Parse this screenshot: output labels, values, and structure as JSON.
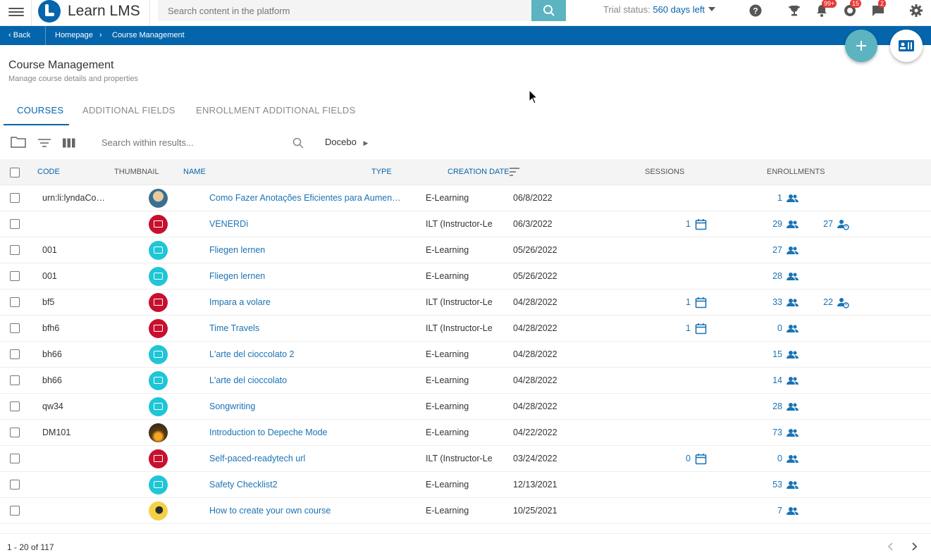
{
  "app": {
    "name": "Learn LMS"
  },
  "search": {
    "placeholder": "Search content in the platform"
  },
  "trial": {
    "label": "Trial status:",
    "value": "560 days left"
  },
  "badges": {
    "notifications": "99+",
    "messages_a": "15",
    "messages_b": "2"
  },
  "breadcrumb": {
    "back": "Back",
    "home": "Homepage",
    "current": "Course Management"
  },
  "page": {
    "title": "Course Management",
    "subtitle": "Manage course details and properties"
  },
  "tabs": [
    {
      "label": "COURSES",
      "active": true
    },
    {
      "label": "ADDITIONAL FIELDS",
      "active": false
    },
    {
      "label": "ENROLLMENT ADDITIONAL FIELDS",
      "active": false
    }
  ],
  "filter": {
    "search_placeholder": "Search within results...",
    "branch": "Docebo"
  },
  "columns": {
    "code": "CODE",
    "thumbnail": "THUMBNAIL",
    "name": "NAME",
    "type": "TYPE",
    "creation_date": "CREATION DATE",
    "sessions": "SESSIONS",
    "enrollments": "ENROLLMENTS"
  },
  "rows": [
    {
      "code": "urn:li:lyndaCourse",
      "thumb": "img1",
      "name": "Como Fazer Anotações Eficientes para Aumenta...",
      "type": "E-Learning",
      "date": "06/8/2022",
      "sessions": "",
      "enrollments": "1",
      "waiting": ""
    },
    {
      "code": "",
      "thumb": "ilt",
      "name": "VENERDì",
      "type": "ILT (Instructor-Le",
      "date": "06/3/2022",
      "sessions": "1",
      "enrollments": "29",
      "waiting": "27"
    },
    {
      "code": "001",
      "thumb": "elearn",
      "name": "Fliegen lernen",
      "type": "E-Learning",
      "date": "05/26/2022",
      "sessions": "",
      "enrollments": "27",
      "waiting": ""
    },
    {
      "code": "001",
      "thumb": "elearn",
      "name": "Fliegen lernen",
      "type": "E-Learning",
      "date": "05/26/2022",
      "sessions": "",
      "enrollments": "28",
      "waiting": ""
    },
    {
      "code": "bf5",
      "thumb": "ilt",
      "name": "Impara a volare",
      "type": "ILT (Instructor-Le",
      "date": "04/28/2022",
      "sessions": "1",
      "enrollments": "33",
      "waiting": "22"
    },
    {
      "code": "bfh6",
      "thumb": "ilt",
      "name": "Time Travels",
      "type": "ILT (Instructor-Le",
      "date": "04/28/2022",
      "sessions": "1",
      "enrollments": "0",
      "waiting": ""
    },
    {
      "code": "bh66",
      "thumb": "elearn",
      "name": "L'arte del cioccolato 2",
      "type": "E-Learning",
      "date": "04/28/2022",
      "sessions": "",
      "enrollments": "15",
      "waiting": ""
    },
    {
      "code": "bh66",
      "thumb": "elearn",
      "name": "L'arte del cioccolato",
      "type": "E-Learning",
      "date": "04/28/2022",
      "sessions": "",
      "enrollments": "14",
      "waiting": ""
    },
    {
      "code": "qw34",
      "thumb": "elearn",
      "name": "Songwriting",
      "type": "E-Learning",
      "date": "04/28/2022",
      "sessions": "",
      "enrollments": "28",
      "waiting": ""
    },
    {
      "code": "DM101",
      "thumb": "img2",
      "name": "Introduction to Depeche Mode",
      "type": "E-Learning",
      "date": "04/22/2022",
      "sessions": "",
      "enrollments": "73",
      "waiting": ""
    },
    {
      "code": "",
      "thumb": "ilt",
      "name": "Self-paced-readytech url",
      "type": "ILT (Instructor-Le",
      "date": "03/24/2022",
      "sessions": "0",
      "enrollments": "0",
      "waiting": ""
    },
    {
      "code": "",
      "thumb": "elearn",
      "name": "Safety Checklist2",
      "type": "E-Learning",
      "date": "12/13/2021",
      "sessions": "",
      "enrollments": "53",
      "waiting": ""
    },
    {
      "code": "",
      "thumb": "img3",
      "name": "How to create your own course",
      "type": "E-Learning",
      "date": "10/25/2021",
      "sessions": "",
      "enrollments": "7",
      "waiting": ""
    }
  ],
  "pagination": {
    "summary": "1 - 20 of 117"
  },
  "icons": {
    "menu": "hamburger-icon",
    "search": "search-icon",
    "help": "help-icon",
    "trophy": "trophy-icon",
    "bell": "bell-icon",
    "chat": "chat-icon",
    "settings": "gear-icon",
    "folder": "folder-icon",
    "filter": "filter-icon",
    "columns": "columns-icon",
    "calendar": "calendar-icon",
    "users": "users-icon",
    "waiting": "waiting-user-icon"
  },
  "colors": {
    "brand": "#0465ac",
    "accent": "#5bb4c0",
    "ilt": "#c8102e",
    "elearning": "#1ec6d6",
    "badge": "#e53935"
  }
}
